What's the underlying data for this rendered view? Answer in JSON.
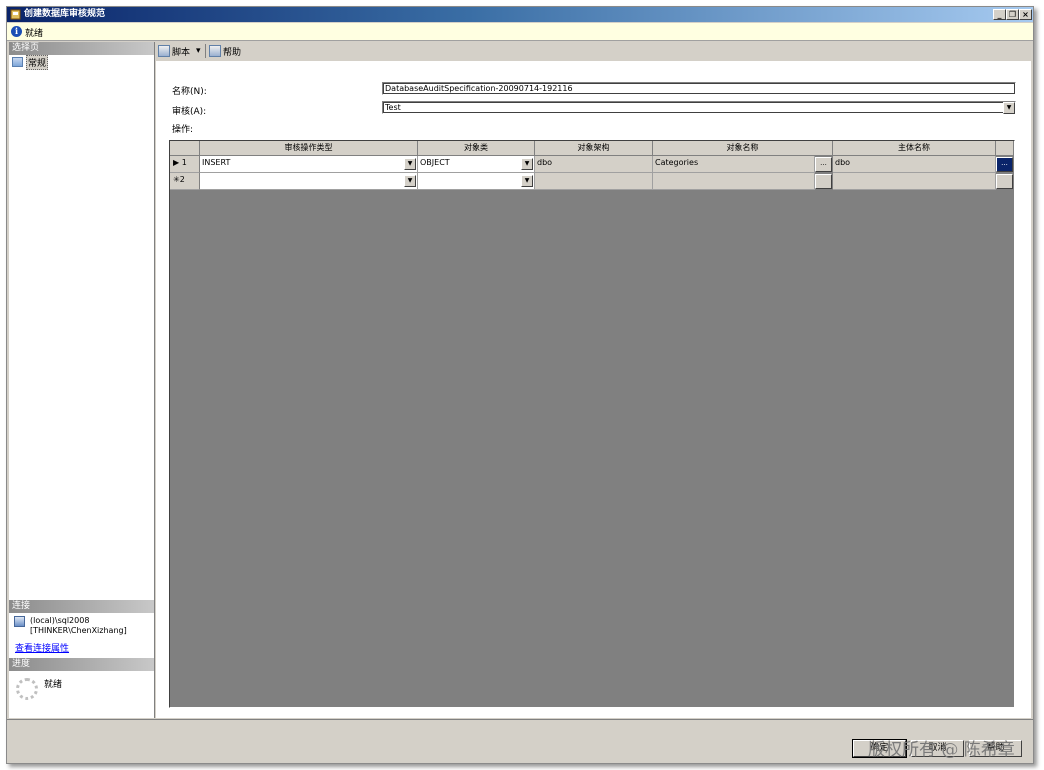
{
  "window": {
    "title": "创建数据库审核规范",
    "controls": {
      "minimize": "_",
      "restore": "❐",
      "close": "×"
    }
  },
  "status": {
    "text": "就绪",
    "icon": "info-icon"
  },
  "left_pane": {
    "select_page_header": "选择页",
    "pages": [
      {
        "label": "常规",
        "icon": "general-page-icon"
      }
    ],
    "connection_header": "连接",
    "server": "(local)\\sql2008",
    "user": "[THINKER\\ChenXizhang]",
    "view_connection_link": "查看连接属性",
    "progress_header": "进度",
    "progress_status": "就绪"
  },
  "toolbar": {
    "script_label": "脚本",
    "script_arrow": "▾",
    "help_label": "帮助"
  },
  "form": {
    "name_label": "名称(N):",
    "name_value": "DatabaseAuditSpecification-20090714-192116",
    "audit_label": "审核(A):",
    "audit_value": "Test",
    "actions_label": "操作:"
  },
  "grid": {
    "columns": [
      "审核操作类型",
      "对象类",
      "对象架构",
      "对象名称",
      "主体名称"
    ],
    "rows": [
      {
        "marker": "▶ 1",
        "action_type": "INSERT",
        "object_class": "OBJECT",
        "object_schema": "dbo",
        "object_name": "Categories",
        "principal_name": "dbo"
      },
      {
        "marker": "✳2",
        "action_type": "",
        "object_class": "",
        "object_schema": "",
        "object_name": "",
        "principal_name": ""
      }
    ],
    "ellipsis": "..."
  },
  "buttons": {
    "ok": "确定",
    "cancel": "取消",
    "help": "帮助"
  },
  "watermark": "版权所有 @ 陈希章",
  "colors": {
    "title_bar_start": "#0a246a",
    "title_bar_end": "#a6caf0",
    "status_bg": "#ffffe1",
    "dialog_bg": "#d4d0c8",
    "link": "#0000ff"
  }
}
